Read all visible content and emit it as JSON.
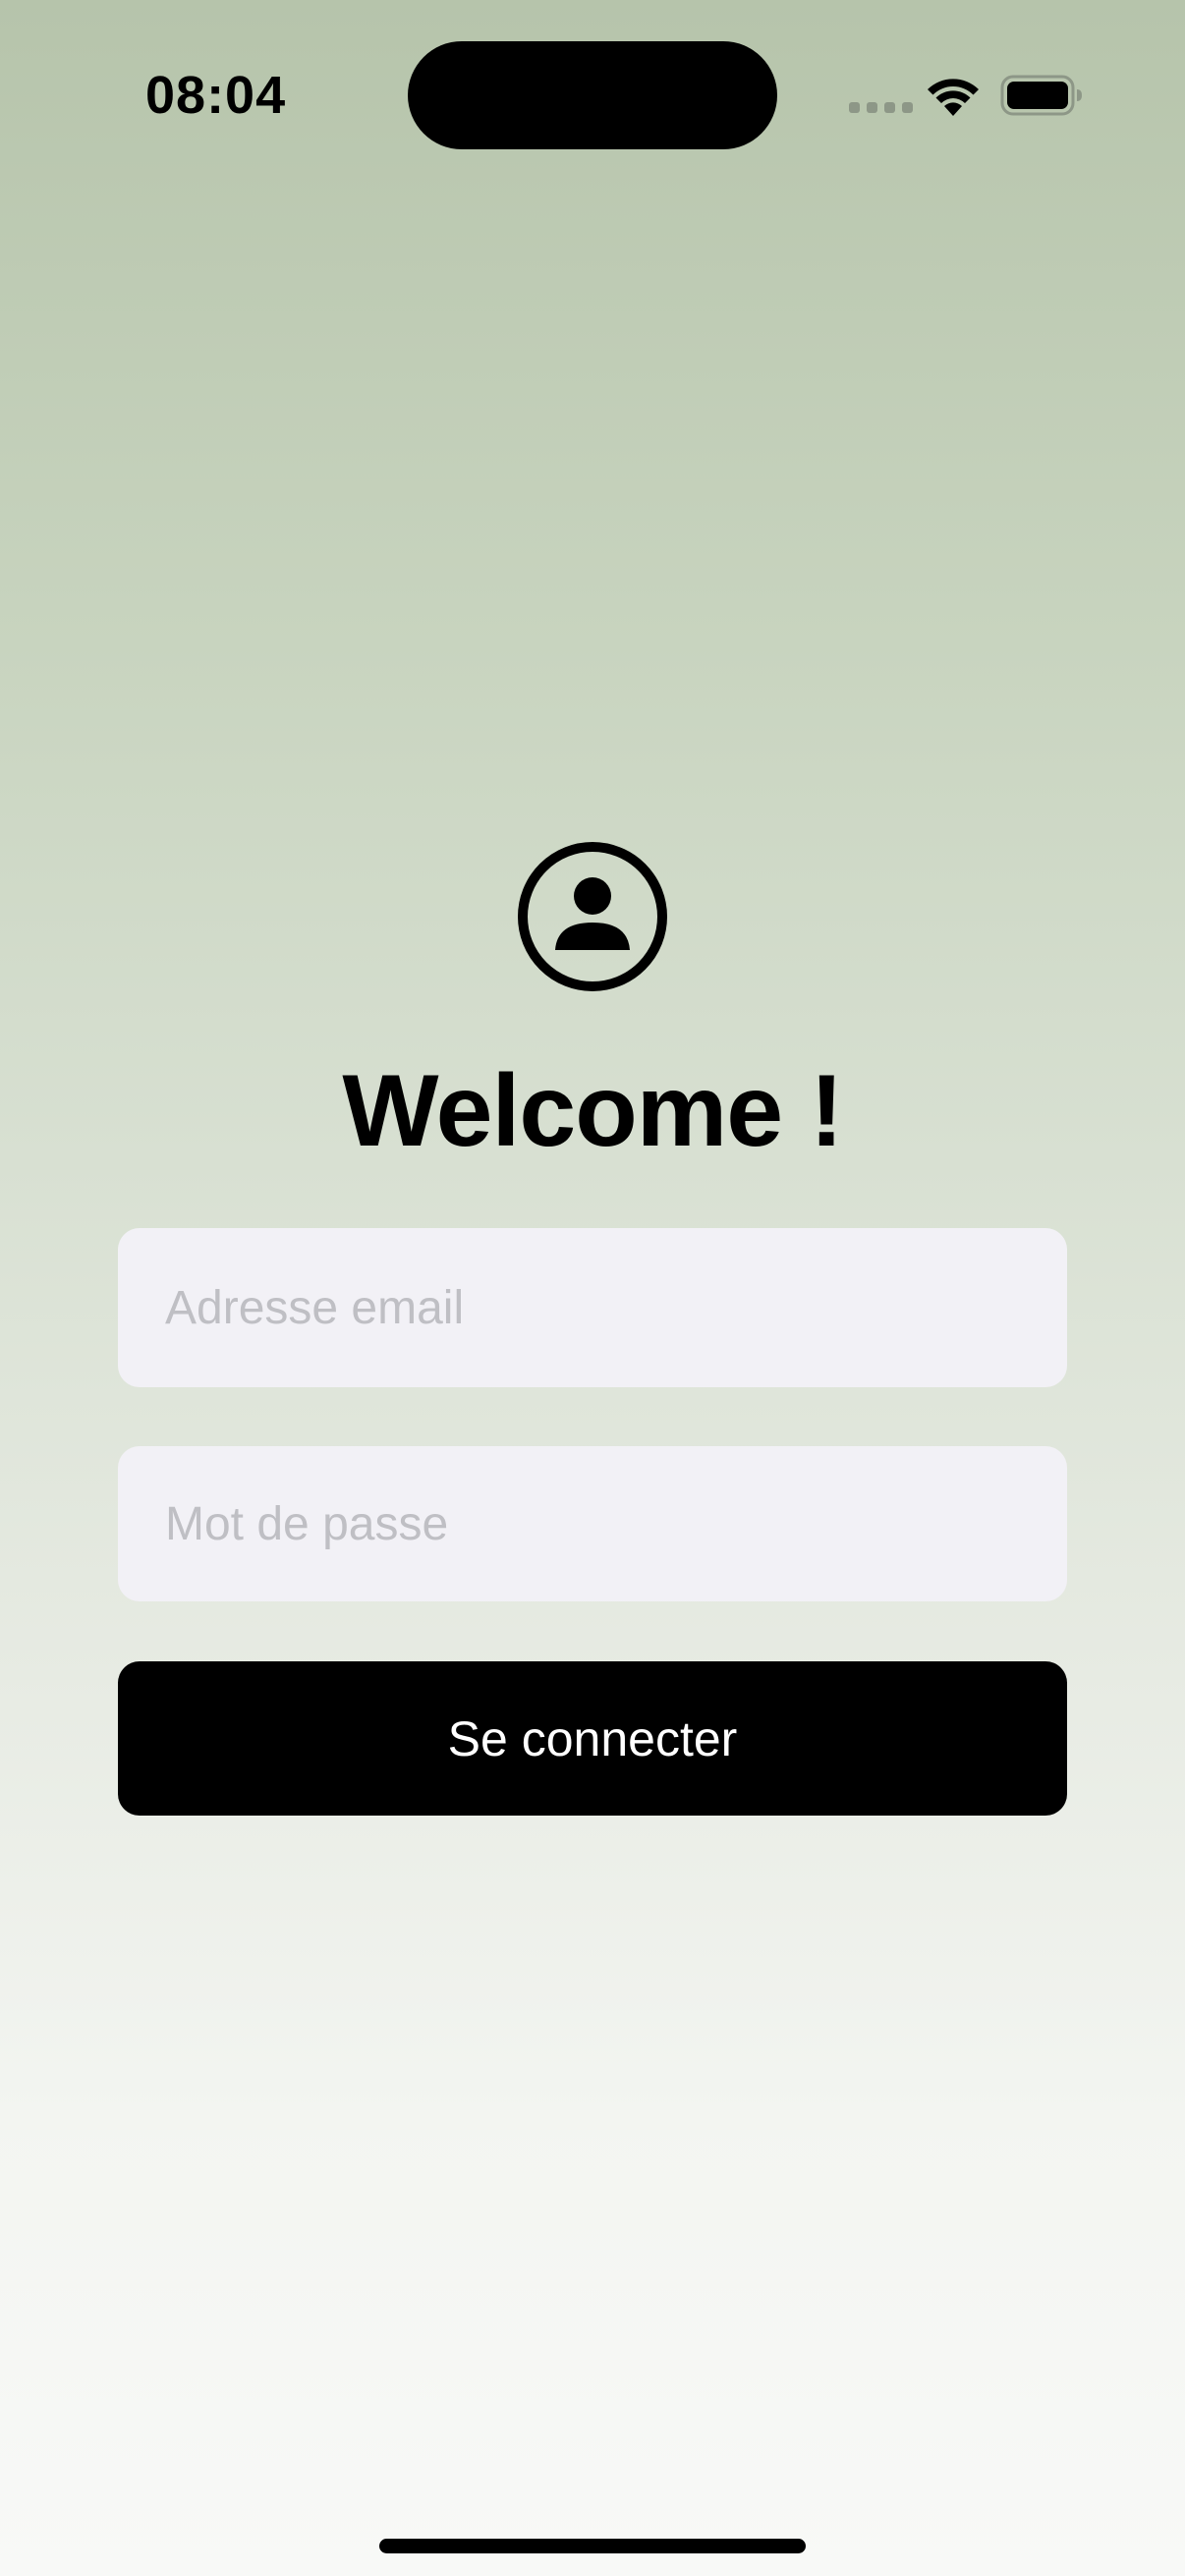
{
  "status_bar": {
    "time": "08:04"
  },
  "login": {
    "title": "Welcome !",
    "email_placeholder": "Adresse email",
    "password_placeholder": "Mot de passe",
    "submit_label": "Se connecter"
  },
  "icons": {
    "avatar": "person-circle-icon",
    "wifi": "wifi-icon",
    "battery": "battery-icon",
    "signal": "cellular-signal-icon"
  },
  "colors": {
    "background_top": "#b6c4ab",
    "background_bottom": "#f8f9f7",
    "field_background": "#f2f1f6",
    "placeholder": "#bfbfc4",
    "button_background": "#000000",
    "button_text": "#ffffff"
  }
}
